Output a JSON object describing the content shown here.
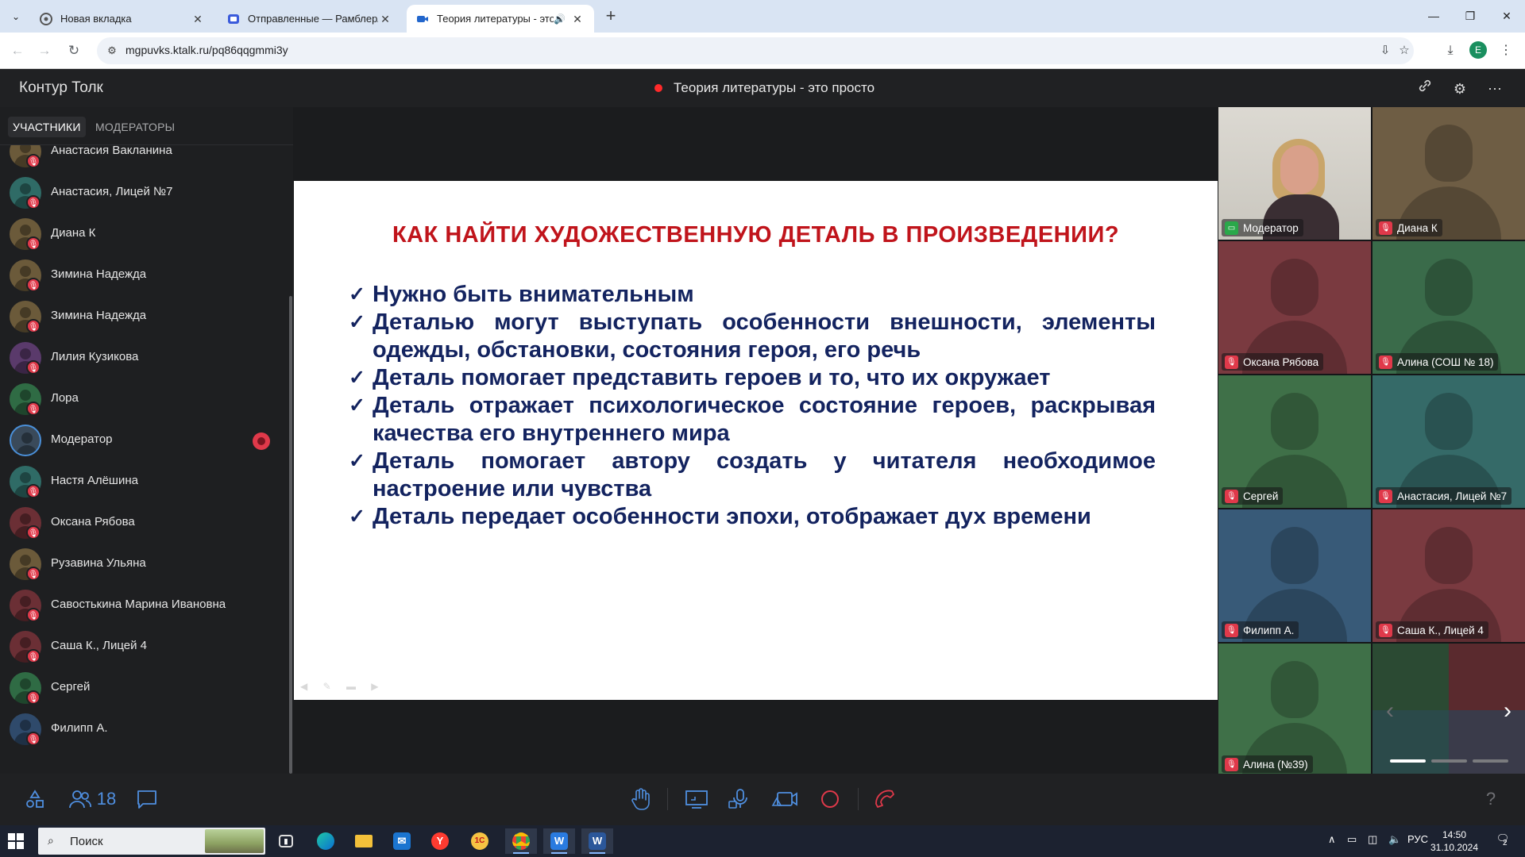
{
  "browser": {
    "tabs": [
      {
        "title": "Новая вкладка",
        "active": false
      },
      {
        "title": "Отправленные — Рамблер/почта",
        "active": false
      },
      {
        "title": "Теория литературы - это просто",
        "active": true
      }
    ],
    "url": "mgpuvks.ktalk.ru/pq86qqgmmi3y",
    "profile_initial": "E"
  },
  "app": {
    "logo": "Контур Толк",
    "meeting_title": "Теория литературы - это просто",
    "accent": "#4f8fe0",
    "recording_color": "#ff2a2a"
  },
  "sidebar": {
    "tabs": [
      "УЧАСТНИКИ",
      "МОДЕРАТОРЫ"
    ],
    "participants": [
      {
        "name": "Анастасия Вакланина",
        "color": "#6b5a3a",
        "muted": true,
        "moderator": false
      },
      {
        "name": "Анастасия, Лицей №7",
        "color": "#2f6b66",
        "muted": true,
        "moderator": false
      },
      {
        "name": "Диана К",
        "color": "#6b5a3a",
        "muted": true,
        "moderator": false
      },
      {
        "name": "Зимина Надежда",
        "color": "#6b5a3a",
        "muted": true,
        "moderator": false
      },
      {
        "name": "Зимина Надежда",
        "color": "#6b5a3a",
        "muted": true,
        "moderator": false
      },
      {
        "name": "Лилия Кузикова",
        "color": "#5a3a6b",
        "muted": true,
        "moderator": false
      },
      {
        "name": "Лора",
        "color": "#2f6b44",
        "muted": true,
        "moderator": false
      },
      {
        "name": "Модератор",
        "color": "#3a4a5a",
        "muted": false,
        "moderator": true
      },
      {
        "name": "Настя Алёшина",
        "color": "#2f6b66",
        "muted": true,
        "moderator": false
      },
      {
        "name": "Оксана Рябова",
        "color": "#6b2f35",
        "muted": true,
        "moderator": false
      },
      {
        "name": "Рузавина Ульяна",
        "color": "#6b5a3a",
        "muted": true,
        "moderator": false
      },
      {
        "name": "Савостькина Марина Ивановна",
        "color": "#6b2f35",
        "muted": true,
        "moderator": false
      },
      {
        "name": "Саша К., Лицей 4",
        "color": "#6b2f35",
        "muted": true,
        "moderator": false
      },
      {
        "name": "Сергей",
        "color": "#2f6b44",
        "muted": true,
        "moderator": false
      },
      {
        "name": "Филипп А.",
        "color": "#2f4a6b",
        "muted": true,
        "moderator": false
      }
    ]
  },
  "slide": {
    "title": "КАК НАЙТИ ХУДОЖЕСТВЕННУЮ ДЕТАЛЬ В ПРОИЗВЕДЕНИИ?",
    "bullets": [
      "Нужно быть внимательным",
      "Деталью могут выступать особенности внешности, элементы одежды, обстановки, состояния героя, его речь",
      "Деталь помогает представить героев и то, что их окружает",
      "Деталь отражает психологическое состояние героев, раскрывая качества его внутреннего мира",
      "Деталь помогает автору создать у читателя необходимое настроение или чувства",
      "Деталь передает особенности эпохи, отображает дух времени"
    ],
    "title_color": "#c0141b",
    "text_color": "#13235f"
  },
  "video_tiles": [
    {
      "name": "Модератор",
      "color": "#cfcbc3",
      "video": true,
      "muted": false
    },
    {
      "name": "Диана К",
      "color": "#6e5d44",
      "video": false,
      "muted": true
    },
    {
      "name": "Оксана Рябова",
      "color": "#7a3a40",
      "video": false,
      "muted": true
    },
    {
      "name": "Алина (СОШ № 18)",
      "color": "#3a6b4a",
      "video": false,
      "muted": true
    },
    {
      "name": "Сергей",
      "color": "#3f7048",
      "video": false,
      "muted": true
    },
    {
      "name": "Анастасия, Лицей №7",
      "color": "#356a68",
      "video": false,
      "muted": true
    },
    {
      "name": "Филипп А.",
      "color": "#385a78",
      "video": false,
      "muted": true
    },
    {
      "name": "Саша К., Лицей 4",
      "color": "#7a3a40",
      "video": false,
      "muted": true
    },
    {
      "name": "Алина (№39)",
      "color": "#3f7048",
      "video": false,
      "muted": true
    }
  ],
  "bottombar": {
    "participants_count": "18",
    "help": "?"
  },
  "taskbar": {
    "search_placeholder": "Поиск",
    "language": "РУС",
    "time": "14:50",
    "date": "31.10.2024",
    "notifications": "2"
  }
}
